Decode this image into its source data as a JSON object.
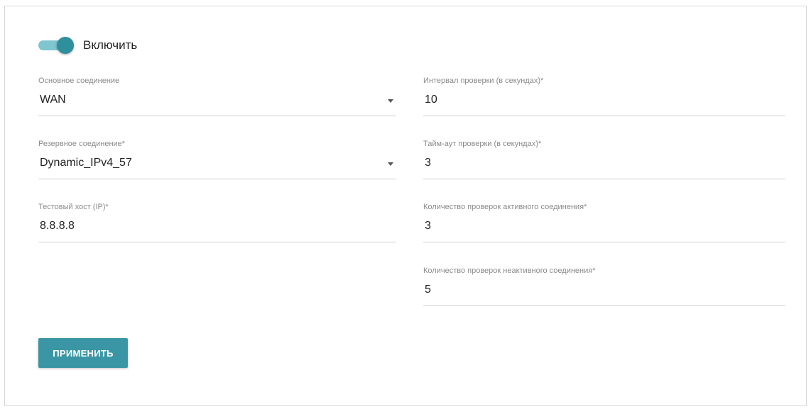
{
  "toggle": {
    "label": "Включить",
    "on": true
  },
  "fields": {
    "primary_connection": {
      "label": "Основное соединение",
      "value": "WAN"
    },
    "backup_connection": {
      "label": "Резервное соединение*",
      "value": "Dynamic_IPv4_57"
    },
    "test_host": {
      "label": "Тестовый хост (IP)*",
      "value": "8.8.8.8"
    },
    "check_interval": {
      "label": "Интервал проверки (в секундах)*",
      "value": "10"
    },
    "check_timeout": {
      "label": "Тайм-аут проверки (в секундах)*",
      "value": "3"
    },
    "active_checks": {
      "label": "Количество проверок активного соединения*",
      "value": "3"
    },
    "inactive_checks": {
      "label": "Количество проверок неактивного соединения*",
      "value": "5"
    }
  },
  "apply_button": {
    "label": "ПРИМЕНИТЬ"
  },
  "colors": {
    "accent": "#3a96a4",
    "toggle_knob": "#2f8f9b",
    "toggle_track": "#7fc6cf"
  }
}
